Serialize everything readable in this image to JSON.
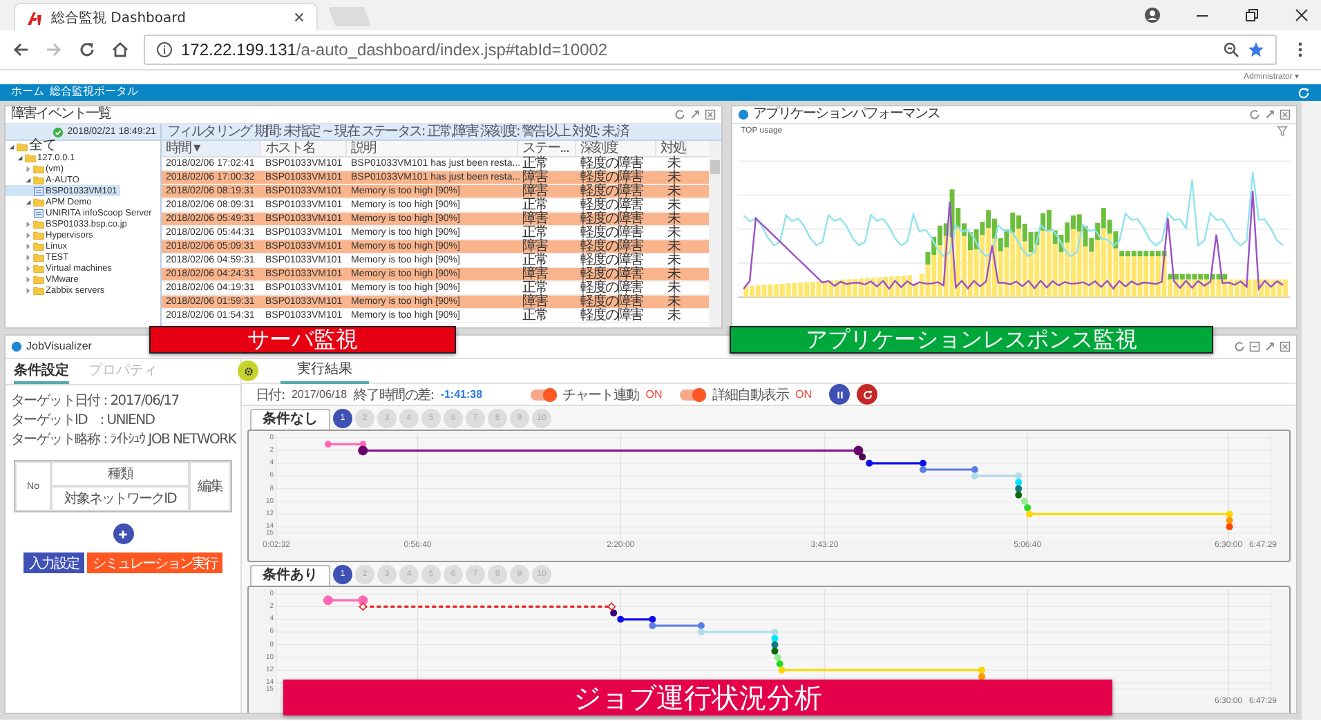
{
  "browser": {
    "tab_title": "総合監視 Dashboard",
    "url_host": "172.22.199.131",
    "url_path": "/a-auto_dashboard/index.jsp#tabId=10002",
    "user_menu": "Administrator ▾"
  },
  "nav": {
    "items": [
      "ホーム",
      "総合監視ポータル"
    ]
  },
  "events_panel": {
    "title": "障害イベント一覧",
    "timestamp": "2018/02/21 18:49:21",
    "filter": "フィルタリング 期間: 未指定 ~ 現在 ステータス: 正常,障害 深刻度: 警告以上 対処: 未,済",
    "tree": [
      {
        "label": "全て",
        "kind": "folder",
        "expanded": true,
        "selected": false,
        "children": [
          {
            "label": "127.0.0.1",
            "kind": "folder",
            "expanded": true,
            "selected": false,
            "children": [
              {
                "label": "(vm)",
                "kind": "folder",
                "expanded": false,
                "selected": false
              },
              {
                "label": "A-AUTO",
                "kind": "folder",
                "expanded": true,
                "selected": false,
                "children": [
                  {
                    "label": "BSP01033VM101",
                    "kind": "host",
                    "selected": true
                  }
                ]
              },
              {
                "label": "APM Demo",
                "kind": "folder",
                "expanded": true,
                "selected": false,
                "children": [
                  {
                    "label": "UNIRITA infoScoop Server",
                    "kind": "host",
                    "selected": false
                  }
                ]
              },
              {
                "label": "BSP01033.bsp.co.jp",
                "kind": "folder",
                "expanded": false,
                "selected": false
              },
              {
                "label": "Hypervisors",
                "kind": "folder",
                "expanded": false,
                "selected": false
              },
              {
                "label": "Linux",
                "kind": "folder",
                "expanded": false,
                "selected": false
              },
              {
                "label": "TEST",
                "kind": "folder",
                "expanded": false,
                "selected": false
              },
              {
                "label": "Virtual machines",
                "kind": "folder",
                "expanded": false,
                "selected": false
              },
              {
                "label": "VMware",
                "kind": "folder",
                "expanded": false,
                "selected": false
              },
              {
                "label": "Zabbix servers",
                "kind": "folder",
                "expanded": false,
                "selected": false
              }
            ]
          }
        ]
      }
    ],
    "columns": [
      "時間 ▾",
      "ホスト名",
      "説明",
      "ステー...",
      "深刻度",
      "対処"
    ],
    "rows": [
      {
        "time": "2018/02/06 17:02:41",
        "host": "BSP01033VM101",
        "description": "BSP01033VM101 has just been resta...",
        "status": "正常",
        "severity": "軽度の障害",
        "action": "未",
        "alert": false
      },
      {
        "time": "2018/02/06 17:00:32",
        "host": "BSP01033VM101",
        "description": "BSP01033VM101 has just been resta...",
        "status": "障害",
        "severity": "軽度の障害",
        "action": "未",
        "alert": true
      },
      {
        "time": "2018/02/06 08:19:31",
        "host": "BSP01033VM101",
        "description": "Memory is too high [90%]",
        "status": "障害",
        "severity": "軽度の障害",
        "action": "未",
        "alert": true
      },
      {
        "time": "2018/02/06 08:09:31",
        "host": "BSP01033VM101",
        "description": "Memory is too high [90%]",
        "status": "正常",
        "severity": "軽度の障害",
        "action": "未",
        "alert": false
      },
      {
        "time": "2018/02/06 05:49:31",
        "host": "BSP01033VM101",
        "description": "Memory is too high [90%]",
        "status": "障害",
        "severity": "軽度の障害",
        "action": "未",
        "alert": true
      },
      {
        "time": "2018/02/06 05:44:31",
        "host": "BSP01033VM101",
        "description": "Memory is too high [90%]",
        "status": "正常",
        "severity": "軽度の障害",
        "action": "未",
        "alert": false
      },
      {
        "time": "2018/02/06 05:09:31",
        "host": "BSP01033VM101",
        "description": "Memory is too high [90%]",
        "status": "障害",
        "severity": "軽度の障害",
        "action": "未",
        "alert": true
      },
      {
        "time": "2018/02/06 04:59:31",
        "host": "BSP01033VM101",
        "description": "Memory is too high [90%]",
        "status": "正常",
        "severity": "軽度の障害",
        "action": "未",
        "alert": false
      },
      {
        "time": "2018/02/06 04:24:31",
        "host": "BSP01033VM101",
        "description": "Memory is too high [90%]",
        "status": "障害",
        "severity": "軽度の障害",
        "action": "未",
        "alert": true
      },
      {
        "time": "2018/02/06 04:19:31",
        "host": "BSP01033VM101",
        "description": "Memory is too high [90%]",
        "status": "正常",
        "severity": "軽度の障害",
        "action": "未",
        "alert": false
      },
      {
        "time": "2018/02/06 01:59:31",
        "host": "BSP01033VM101",
        "description": "Memory is too high [90%]",
        "status": "障害",
        "severity": "軽度の障害",
        "action": "未",
        "alert": true
      },
      {
        "time": "2018/02/06 01:54:31",
        "host": "BSP01033VM101",
        "description": "Memory is too high [90%]",
        "status": "正常",
        "severity": "軽度の障害",
        "action": "未",
        "alert": false
      }
    ]
  },
  "app_panel": {
    "title": "アプリケーションパフォーマンス",
    "chart_label": "TOP usage"
  },
  "job_panel": {
    "title": "JobVisualizer",
    "tabs": [
      {
        "label": "条件設定",
        "selected": true
      },
      {
        "label": "プロパティ",
        "selected": false
      }
    ],
    "target_lines": [
      "ターゲット日付 : 2017/06/17",
      "ターゲットID　: UNIEND",
      "ターゲット略称 : ﾗｲﾄｼｭｳ JOB NETWORK"
    ],
    "table": {
      "no": "No",
      "type": "種類",
      "network": "対象ネットワークID",
      "edit": "編集"
    },
    "buttons": [
      {
        "label": "入力設定",
        "kind": "primary"
      },
      {
        "label": "シミュレーション実行",
        "kind": "danger"
      }
    ],
    "result_tab": {
      "label": "実行結果",
      "selected": true
    },
    "info": {
      "date_label": "日付:",
      "date": "2017/06/18",
      "diff_label": "終了時間の差:",
      "diff": "-1:41:38",
      "toggles": [
        {
          "label": "チャート連動",
          "state": "ON",
          "on": true
        },
        {
          "label": "詳細自動表示",
          "state": "ON",
          "on": true
        }
      ]
    },
    "charts": [
      {
        "tab": "条件なし",
        "pages": [
          {
            "label": "1",
            "selected": true
          },
          {
            "label": "2",
            "selected": false
          },
          {
            "label": "3",
            "selected": false
          },
          {
            "label": "4",
            "selected": false
          },
          {
            "label": "5",
            "selected": false
          },
          {
            "label": "6",
            "selected": false
          },
          {
            "label": "7",
            "selected": false
          },
          {
            "label": "8",
            "selected": false
          },
          {
            "label": "9",
            "selected": false
          },
          {
            "label": "10",
            "selected": false
          }
        ],
        "yticks": [
          "0",
          "2",
          "4",
          "6",
          "8",
          "10",
          "12",
          "14",
          "15"
        ],
        "xticks": [
          "0:02:32",
          "0:56:40",
          "2:20:00",
          "3:43:20",
          "5:06:40",
          "6:30:00",
          "6:47:29"
        ]
      },
      {
        "tab": "条件あり",
        "pages": [
          {
            "label": "1",
            "selected": true
          },
          {
            "label": "2",
            "selected": false
          },
          {
            "label": "3",
            "selected": false
          },
          {
            "label": "4",
            "selected": false
          },
          {
            "label": "5",
            "selected": false
          },
          {
            "label": "6",
            "selected": false
          },
          {
            "label": "7",
            "selected": false
          },
          {
            "label": "8",
            "selected": false
          },
          {
            "label": "9",
            "selected": false
          },
          {
            "label": "10",
            "selected": false
          }
        ],
        "yticks": [
          "0",
          "2",
          "4",
          "6",
          "8",
          "10",
          "12",
          "14",
          "15"
        ],
        "xticks": [
          "6:30:00",
          "6:47:29"
        ]
      }
    ]
  },
  "captions": [
    {
      "text": "サーバ監視",
      "color": "#e60012"
    },
    {
      "text": "アプリケーションレスポンス監視",
      "color": "#00a83c"
    },
    {
      "text": "ジョブ運行状況分析",
      "color": "#e4004b"
    }
  ]
}
